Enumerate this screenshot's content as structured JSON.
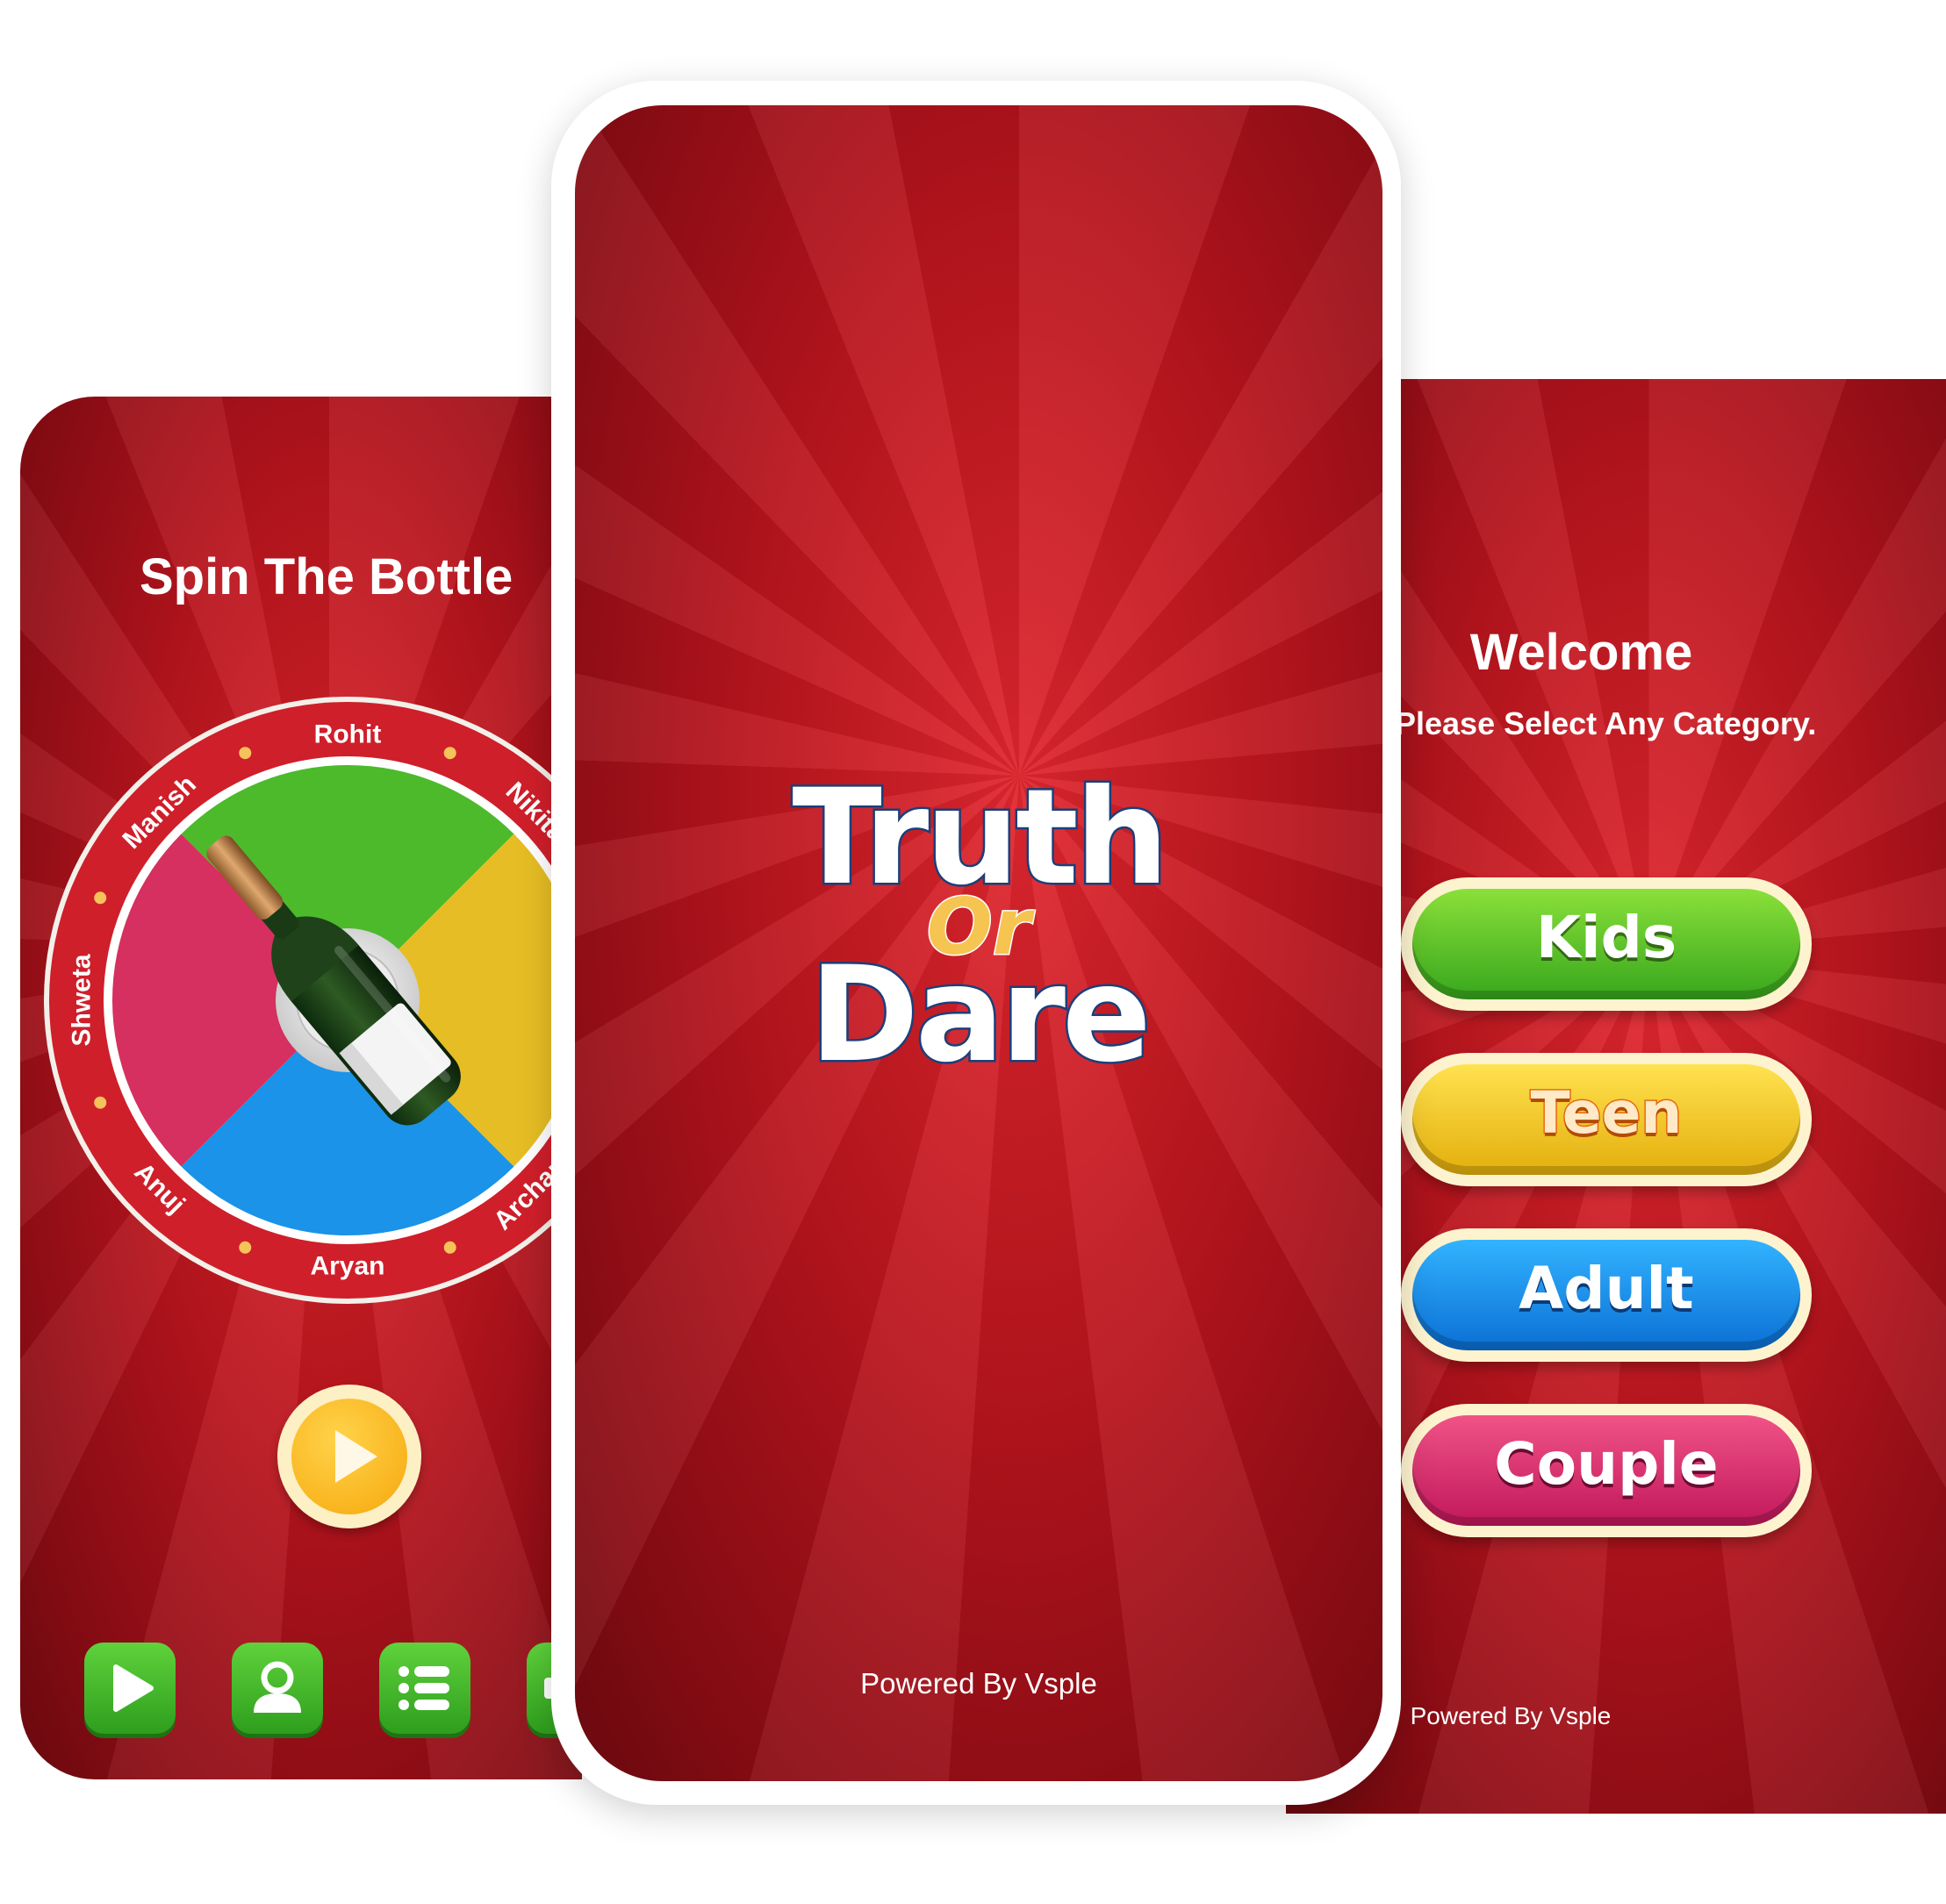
{
  "spin_screen": {
    "title": "Spin The Bottle",
    "players": [
      "Rohit",
      "Nikita",
      "Archana",
      "Aryan",
      "Anuj",
      "Shweta",
      "Manish"
    ],
    "wheel_colors": [
      "#4cba2b",
      "#e6bd24",
      "#1a93e8",
      "#d5305f"
    ],
    "bottle_icon": "champagne-bottle-icon",
    "tabs": [
      {
        "icon": "play-icon"
      },
      {
        "icon": "user-icon"
      },
      {
        "icon": "list-icon"
      },
      {
        "icon": "settings-icon"
      }
    ]
  },
  "splash_screen": {
    "logo": {
      "line1": "Truth",
      "line2": "Or",
      "line3": "Dare"
    },
    "footer": "Powered By Vsple"
  },
  "category_screen": {
    "heading": "Welcome",
    "subheading": "Please Select Any Category.",
    "categories": [
      "Kids",
      "Teen",
      "Adult",
      "Couple"
    ],
    "footer": "Powered By Vsple"
  },
  "colors": {
    "background_red": "#b8141d",
    "button_cream": "#fdf3cf"
  }
}
